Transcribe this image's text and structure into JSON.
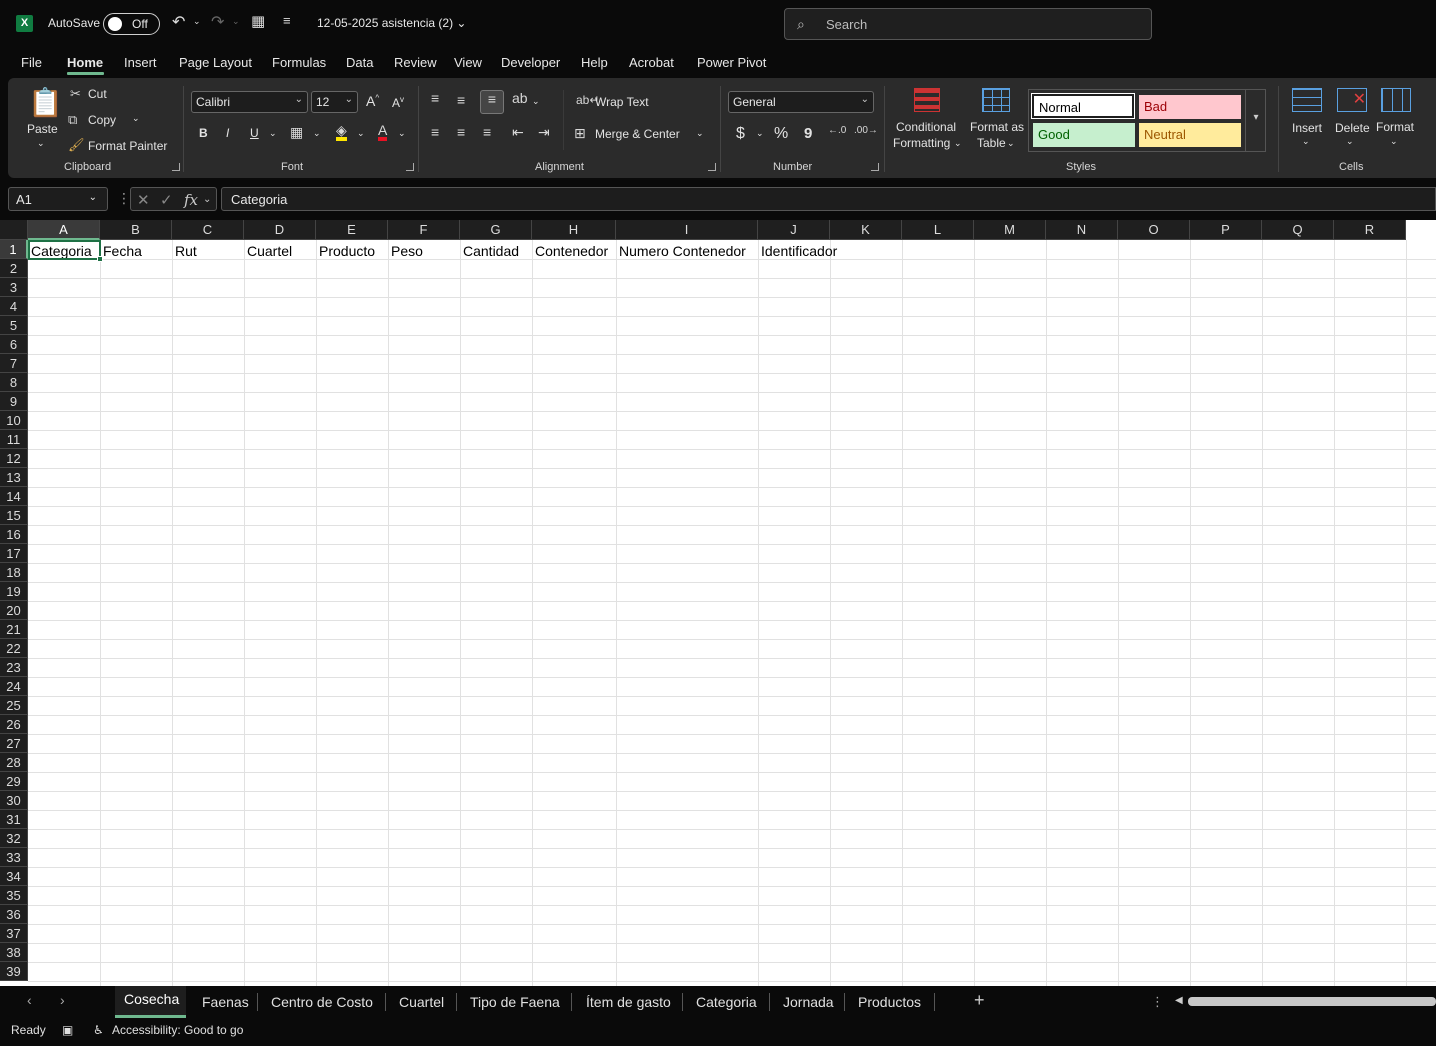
{
  "titlebar": {
    "autosave_label": "AutoSave",
    "autosave_state": "Off",
    "doc_title": "12-05-2025 asistencia (2)",
    "search_placeholder": "Search"
  },
  "menu": [
    "File",
    "Home",
    "Insert",
    "Page Layout",
    "Formulas",
    "Data",
    "Review",
    "View",
    "Developer",
    "Help",
    "Acrobat",
    "Power Pivot"
  ],
  "ribbon": {
    "clipboard": {
      "paste": "Paste",
      "cut": "Cut",
      "copy": "Copy",
      "format_painter": "Format Painter",
      "label": "Clipboard"
    },
    "font": {
      "family": "Calibri",
      "size": "12",
      "bold": "B",
      "italic": "I",
      "underline": "U",
      "label": "Font"
    },
    "alignment": {
      "wrap_text": "Wrap Text",
      "merge_center": "Merge & Center",
      "label": "Alignment"
    },
    "number": {
      "format": "General",
      "currency": "$",
      "percent": "%",
      "comma": "9",
      "label": "Number"
    },
    "styles": {
      "conditional": "Conditional",
      "formatting": "Formatting",
      "format_as": "Format as",
      "table": "Table",
      "normal": "Normal",
      "bad": "Bad",
      "good": "Good",
      "neutral": "Neutral",
      "label": "Styles"
    },
    "cells": {
      "insert": "Insert",
      "delete": "Delete",
      "format": "Format",
      "label": "Cells"
    }
  },
  "formula_bar": {
    "name_box": "A1",
    "fx": "fx",
    "content": "Categoria"
  },
  "columns": [
    "A",
    "B",
    "C",
    "D",
    "E",
    "F",
    "G",
    "H",
    "I",
    "J",
    "K",
    "L",
    "M",
    "N",
    "O",
    "P",
    "Q",
    "R"
  ],
  "row1": [
    "Categoria",
    "Fecha",
    "Rut",
    "Cuartel",
    "Producto",
    "Peso",
    "Cantidad",
    "Contenedor",
    "Numero Contenedor",
    "Identificador"
  ],
  "rows": [
    "1",
    "2",
    "3",
    "4",
    "5",
    "6",
    "7",
    "8",
    "9",
    "10",
    "11",
    "12",
    "13",
    "14",
    "15",
    "16",
    "17",
    "18",
    "19",
    "20",
    "21",
    "22",
    "23",
    "24",
    "25",
    "26",
    "27",
    "28",
    "29",
    "30",
    "31",
    "32",
    "33",
    "34",
    "35",
    "36",
    "37",
    "38",
    "39"
  ],
  "sheets": [
    "Cosecha",
    "Faenas",
    "Centro de Costo",
    "Cuartel",
    "Tipo de Faena",
    "Ítem de gasto",
    "Categoria",
    "Jornada",
    "Productos"
  ],
  "status": {
    "ready": "Ready",
    "accessibility": "Accessibility: Good to go"
  },
  "colors": {
    "accent": "#6fb98f",
    "excel_green": "#107c41",
    "active_cell_border": "#1e7145"
  }
}
